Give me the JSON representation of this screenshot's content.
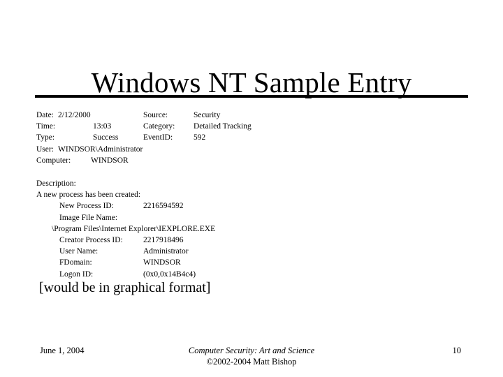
{
  "slide": {
    "title": "Windows NT Sample Entry"
  },
  "event_header": {
    "rows": [
      {
        "left_label": "Date:",
        "left_value": "2/12/2000",
        "left_inline": true,
        "right_label": "Source:",
        "right_value": "Security"
      },
      {
        "left_label": "Time:",
        "left_value": "13:03",
        "left_inline": false,
        "right_label": "Category:",
        "right_value": "Detailed Tracking"
      },
      {
        "left_label": "Type:",
        "left_value": "Success",
        "left_inline": false,
        "right_label": "EventID:",
        "right_value": "592"
      },
      {
        "left_label": "User:",
        "left_value": "WINDSOR\\Administrator",
        "left_inline": true,
        "right_label": "",
        "right_value": ""
      },
      {
        "left_label": "Computer:",
        "left_value": "WINDSOR",
        "left_inline": false,
        "right_label": "",
        "right_value": ""
      }
    ]
  },
  "description": {
    "heading": "Description:",
    "summary": "A new process has been created:",
    "fields": [
      {
        "label": "New Process ID:",
        "value": "2216594592"
      },
      {
        "label": "Image File Name:",
        "value": ""
      }
    ],
    "image_file_path": "\\Program Files\\Internet Explorer\\IEXPLORE.EXE",
    "fields2": [
      {
        "label": "Creator Process ID:",
        "value": "2217918496"
      },
      {
        "label": "User Name:",
        "value": "Administrator"
      },
      {
        "label": "FDomain:",
        "value": "WINDSOR"
      },
      {
        "label": "Logon ID:",
        "value": "(0x0,0x14B4c4)"
      }
    ]
  },
  "note": {
    "text": "[would be in graphical format]"
  },
  "footer": {
    "date": "June 1, 2004",
    "book_title": "Computer Security: Art and Science",
    "copyright": "©2002-2004 Matt Bishop",
    "page_number": "10"
  }
}
